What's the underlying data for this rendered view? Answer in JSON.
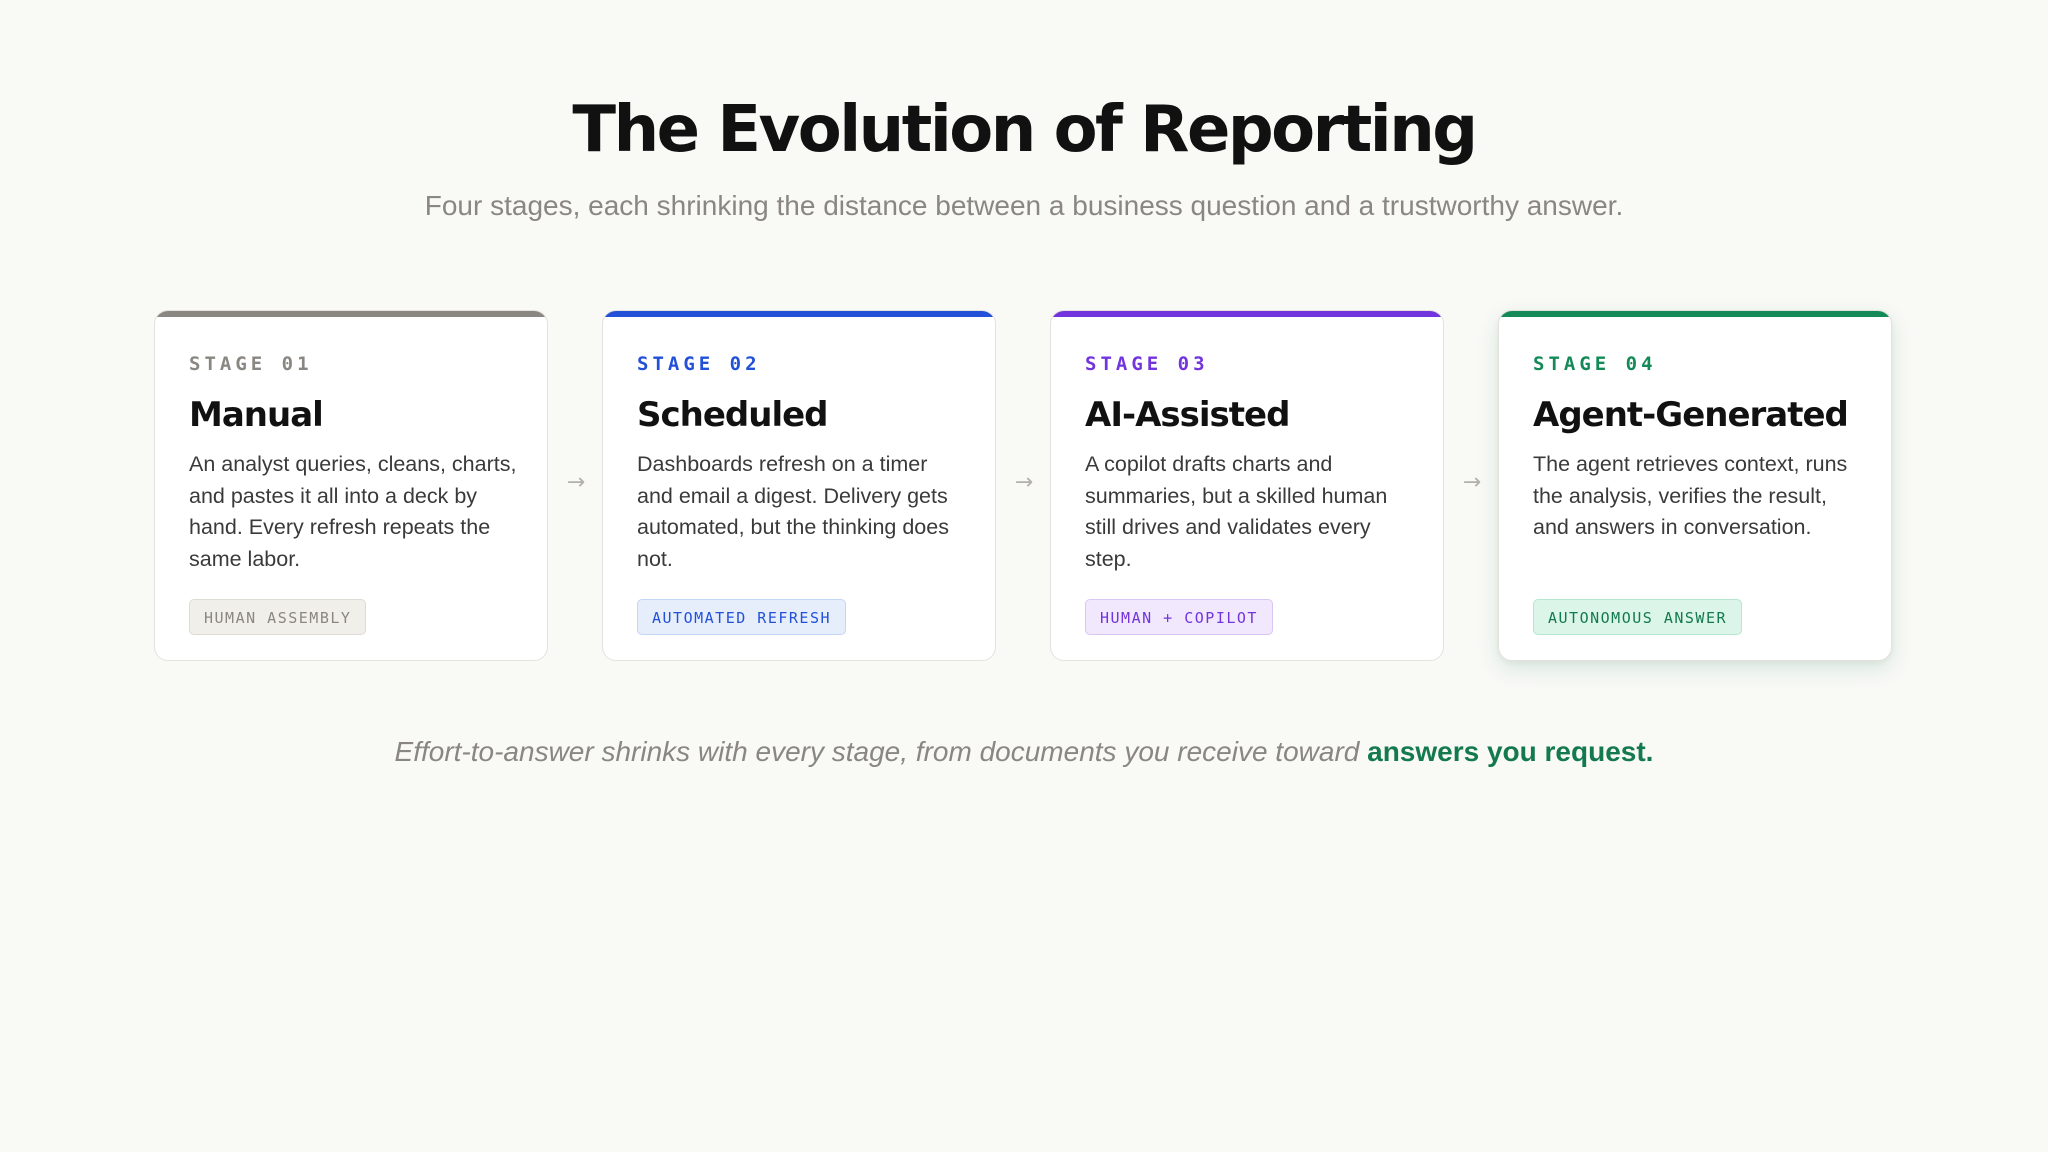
{
  "header": {
    "title": "The Evolution of Reporting",
    "subtitle": "Four stages, each shrinking the distance between a business question and a trustworthy answer."
  },
  "stages": [
    {
      "stage_label": "STAGE 01",
      "title": "Manual",
      "description": "An analyst queries, cleans, charts, and pastes it all into a deck by hand. Every refresh repeats the same labor.",
      "tag": "HUMAN ASSEMBLY",
      "colors": {
        "accent": "#8a8782",
        "label": "#8a8782",
        "tag_bg": "#f1efea",
        "tag_border": "#dedbd4",
        "tag_text": "#8a8782"
      }
    },
    {
      "stage_label": "STAGE 02",
      "title": "Scheduled",
      "description": "Dashboards refresh on a timer and email a digest. Delivery gets automated, but the thinking does not.",
      "tag": "AUTOMATED REFRESH",
      "colors": {
        "accent": "#2251d8",
        "label": "#2251d8",
        "tag_bg": "#e6eefc",
        "tag_border": "#c5d5f5",
        "tag_text": "#2251d8"
      }
    },
    {
      "stage_label": "STAGE 03",
      "title": "AI-Assisted",
      "description": "A copilot drafts charts and summaries, but a skilled human still drives and validates every step.",
      "tag": "HUMAN + COPILOT",
      "colors": {
        "accent": "#7234dc",
        "label": "#7234dc",
        "tag_bg": "#f1e8fd",
        "tag_border": "#d9c6f5",
        "tag_text": "#7234dc"
      }
    },
    {
      "stage_label": "STAGE 04",
      "title": "Agent-Generated",
      "description": "The agent retrieves context, runs the analysis, verifies the result, and answers in conversation.",
      "tag": "AUTONOMOUS ANSWER",
      "colors": {
        "accent": "#158a58",
        "label": "#158a58",
        "tag_bg": "#dbf5e8",
        "tag_border": "#b6e6cf",
        "tag_text": "#147a4e"
      }
    }
  ],
  "connectors": [
    "→",
    "→",
    "→"
  ],
  "footnote": {
    "text": "Effort-to-answer shrinks with every stage, from documents you receive toward",
    "highlight": "answers you request."
  }
}
